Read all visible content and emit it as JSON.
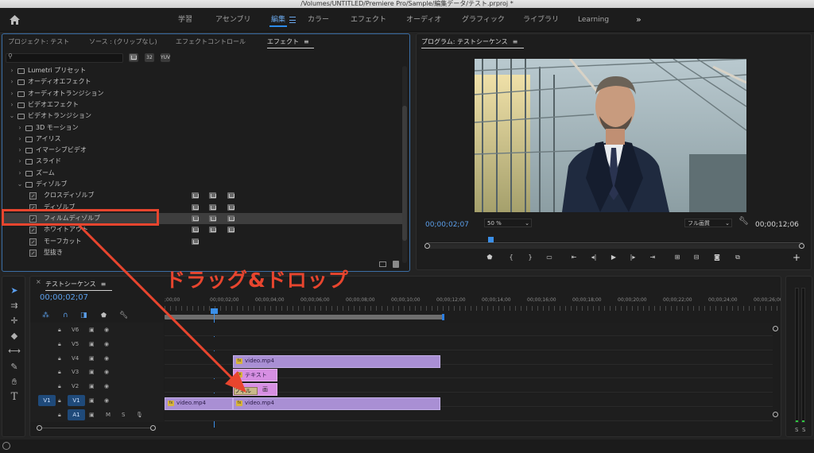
{
  "window": {
    "title": "/Volumes/UNTITLED/Premiere Pro/Sample/編集データ/テスト.prproj *"
  },
  "workspace": {
    "items": [
      "学習",
      "アセンブリ",
      "編集",
      "カラー",
      "エフェクト",
      "オーディオ",
      "グラフィック",
      "ライブラリ",
      "Learning"
    ],
    "active": "編集"
  },
  "effects_panel": {
    "tabs": [
      "プロジェクト: テスト",
      "ソース : (クリップなし)",
      "エフェクトコントロール",
      "エフェクト"
    ],
    "active_tab": "エフェクト",
    "search_value": "",
    "filter_buttons": [
      "32",
      "YUV"
    ],
    "tree": [
      {
        "label": "Lumetri プリセット",
        "level": 0,
        "kind": "folder",
        "expanded": false
      },
      {
        "label": "オーディオエフェクト",
        "level": 0,
        "kind": "folder",
        "expanded": false
      },
      {
        "label": "オーディオトランジション",
        "level": 0,
        "kind": "folder",
        "expanded": false
      },
      {
        "label": "ビデオエフェクト",
        "level": 0,
        "kind": "folder",
        "expanded": false
      },
      {
        "label": "ビデオトランジション",
        "level": 0,
        "kind": "folder",
        "expanded": true
      },
      {
        "label": "3D モーション",
        "level": 1,
        "kind": "folder",
        "expanded": false
      },
      {
        "label": "アイリス",
        "level": 1,
        "kind": "folder",
        "expanded": false
      },
      {
        "label": "イマーシブビデオ",
        "level": 1,
        "kind": "folder",
        "expanded": false
      },
      {
        "label": "スライド",
        "level": 1,
        "kind": "folder",
        "expanded": false
      },
      {
        "label": "ズーム",
        "level": 1,
        "kind": "folder",
        "expanded": false
      },
      {
        "label": "ディゾルブ",
        "level": 1,
        "kind": "folder",
        "expanded": true
      },
      {
        "label": "クロスディゾルブ",
        "level": 2,
        "kind": "effect",
        "badges": 3
      },
      {
        "label": "ディゾルブ",
        "level": 2,
        "kind": "effect",
        "badges": 3
      },
      {
        "label": "フィルムディゾルブ",
        "level": 2,
        "kind": "effect",
        "badges": 3,
        "selected": true
      },
      {
        "label": "ホワイトアウト",
        "level": 2,
        "kind": "effect",
        "badges": 3
      },
      {
        "label": "モーフカット",
        "level": 2,
        "kind": "effect",
        "badges": 1
      },
      {
        "label": "型抜き",
        "level": 2,
        "kind": "effect",
        "badges": 0
      }
    ]
  },
  "program": {
    "title": "プログラム: テストシーケンス",
    "timecode": "00;00;02;07",
    "zoom": "50 %",
    "quality": "フル画質",
    "duration": "00;00;12;06"
  },
  "annotation": {
    "text": "ドラッグ&ドロップ",
    "color": "#e8452e"
  },
  "timeline": {
    "sequence": "テストシーケンス",
    "timecode": "00;00;02;07",
    "ruler": [
      ";00;00",
      "00;00;02;00",
      "00;00;04;00",
      "00;00;06;00",
      "00;00;08;00",
      "00;00;10;00",
      "00;00;12;00",
      "00;00;14;00",
      "00;00;16;00",
      "00;00;18;00",
      "00;00;20;00",
      "00;00;22;00",
      "00;00;24;00",
      "00;00;26;00"
    ],
    "video_tracks": [
      "V6",
      "V5",
      "V4",
      "V3",
      "V2",
      "V1"
    ],
    "audio_tracks": [
      "A1"
    ],
    "source_patch": "V1",
    "audio_buttons": [
      "M",
      "S"
    ],
    "clips": {
      "v4": "video.mp4",
      "v3": "テキスト",
      "v2_transition": "フィル",
      "v2_small": "画",
      "v1_a": "video.mp4",
      "v1_b": "video.mp4"
    }
  },
  "meter": {
    "labels": [
      "S",
      "S"
    ]
  }
}
